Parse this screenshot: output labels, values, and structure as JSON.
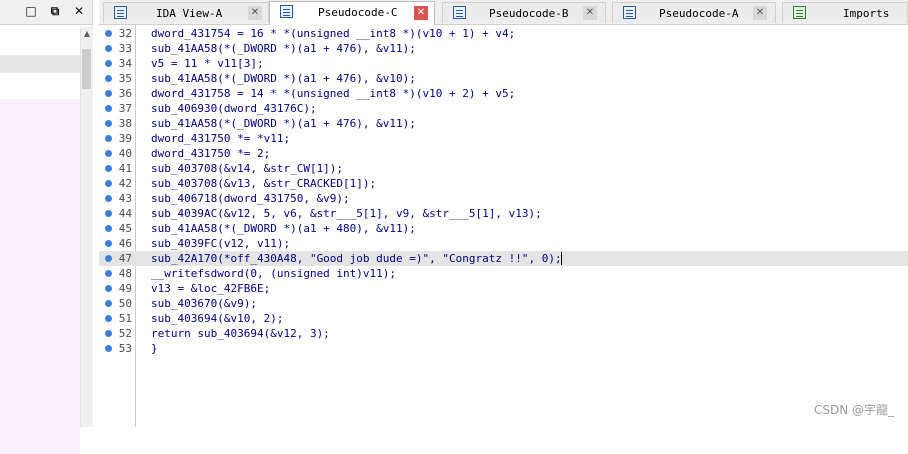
{
  "left_pane": {
    "buttons": [
      {
        "name": "restore",
        "glyph": "□"
      },
      {
        "name": "maximize",
        "glyph": "⧉"
      },
      {
        "name": "close",
        "glyph": "✕"
      }
    ]
  },
  "tabs": [
    {
      "label": "IDA View-A",
      "active": false,
      "icon": "listing-icon"
    },
    {
      "label": "Pseudocode-C",
      "active": true,
      "icon": "pseudocode-icon"
    },
    {
      "label": "Pseudocode-B",
      "active": false,
      "icon": "pseudocode-icon"
    },
    {
      "label": "Pseudocode-A",
      "active": false,
      "icon": "pseudocode-icon"
    },
    {
      "label": "Imports",
      "active": false,
      "icon": "imports-icon"
    }
  ],
  "tab_close_glyph": "✕",
  "code": [
    {
      "n": "32",
      "text": "dword_431754 = 16 * *(unsigned __int8 *)(v10 + 1) + v4;"
    },
    {
      "n": "33",
      "text": "sub_41AA58(*(_DWORD *)(a1 + 476), &v11);"
    },
    {
      "n": "34",
      "text": "v5 = 11 * v11[3];"
    },
    {
      "n": "35",
      "text": "sub_41AA58(*(_DWORD *)(a1 + 476), &v10);"
    },
    {
      "n": "36",
      "text": "dword_431758 = 14 * *(unsigned __int8 *)(v10 + 2) + v5;"
    },
    {
      "n": "37",
      "text": "sub_406930(dword_43176C);"
    },
    {
      "n": "38",
      "text": "sub_41AA58(*(_DWORD *)(a1 + 476), &v11);"
    },
    {
      "n": "39",
      "text": "dword_431750 *= *v11;"
    },
    {
      "n": "40",
      "text": "dword_431750 *= 2;"
    },
    {
      "n": "41",
      "text": "sub_403708(&v14, &str_CW[1]);"
    },
    {
      "n": "42",
      "text": "sub_403708(&v13, &str_CRACKED[1]);"
    },
    {
      "n": "43",
      "text": "sub_406718(dword_431750, &v9);"
    },
    {
      "n": "44",
      "text": "sub_4039AC(&v12, 5, v6, &str___5[1], v9, &str___5[1], v13);"
    },
    {
      "n": "45",
      "text": "sub_41AA58(*(_DWORD *)(a1 + 480), &v11);"
    },
    {
      "n": "46",
      "text": "sub_4039FC(v12, v11);"
    },
    {
      "n": "47",
      "text": "sub_42A170(*off_430A48, \"Good job dude =)\", \"Congratz !!\", 0);",
      "highlight": true
    },
    {
      "n": "48",
      "text": "__writefsdword(0, (unsigned int)v11);"
    },
    {
      "n": "49",
      "text": "v13 = &loc_42FB6E;"
    },
    {
      "n": "50",
      "text": "sub_403670(&v9);"
    },
    {
      "n": "51",
      "text": "sub_403694(&v10, 2);"
    },
    {
      "n": "52",
      "text": "return sub_403694(&v12, 3);"
    },
    {
      "n": "53",
      "text": "}"
    }
  ],
  "watermark": "CSDN @宇龍_",
  "colors": {
    "code_text": "#000080",
    "breakpoint_dot": "#3d7fd6",
    "highlight_row": "#e4e4e4",
    "active_tab_close": "#d9534f"
  }
}
